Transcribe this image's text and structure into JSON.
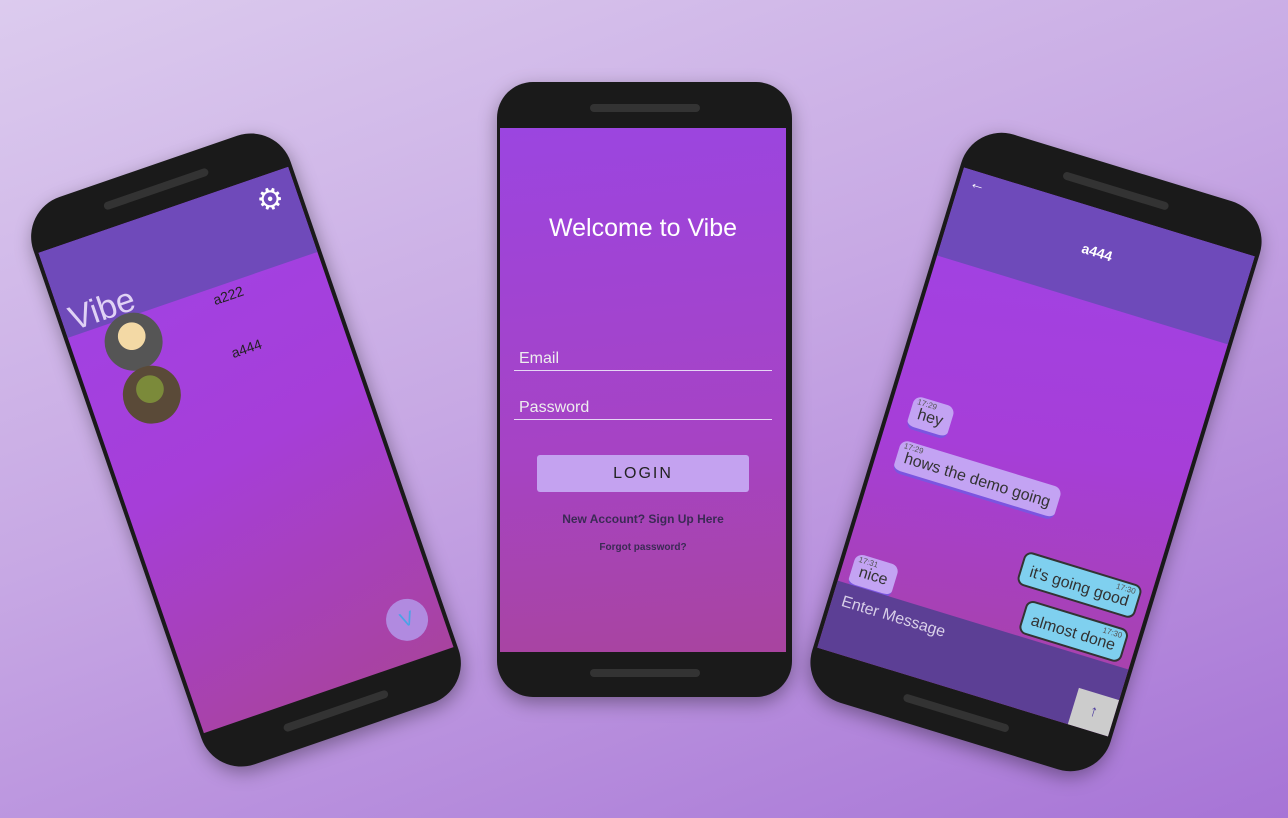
{
  "contacts_screen": {
    "app_title": "Vibe",
    "settings_icon": "gear-icon",
    "contacts": [
      {
        "name": "a222"
      },
      {
        "name": "a444"
      }
    ],
    "fab_icon": "vibe-logo-icon"
  },
  "login_screen": {
    "title": "Welcome to Vibe",
    "email_placeholder": "Email",
    "password_placeholder": "Password",
    "login_label": "LOGIN",
    "signup_link": "New Account? Sign Up Here",
    "forgot_link": "Forgot password?"
  },
  "chat_screen": {
    "contact_name": "a444",
    "back_icon": "←",
    "messages": [
      {
        "text": "hey",
        "time": "17:29",
        "direction": "in"
      },
      {
        "text": "hows the demo going",
        "time": "17:29",
        "direction": "in"
      },
      {
        "text": "it's going good",
        "time": "17:30",
        "direction": "out"
      },
      {
        "text": "almost done",
        "time": "17:30",
        "direction": "out"
      },
      {
        "text": "nice",
        "time": "17:31",
        "direction": "in"
      }
    ],
    "input_placeholder": "Enter Message",
    "send_icon": "↑"
  },
  "colors": {
    "appbar": "#6f4aba",
    "screen": "#a043e6",
    "bubble_in": "#c3a3f3",
    "bubble_out": "#7fd0ef"
  }
}
